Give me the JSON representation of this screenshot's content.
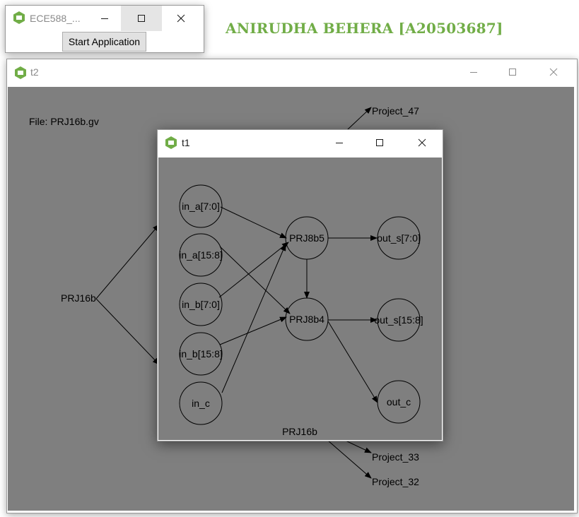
{
  "heading": "ANIRUDHA BEHERA [A20503687]",
  "colors": {
    "accent": "#71ad47",
    "canvas": "#7f7f7f",
    "titlebar": "#ffffff"
  },
  "main_window": {
    "title": "ECE588_...",
    "start_button": "Start Application",
    "icon": "app-icon"
  },
  "t2_window": {
    "title": "t2",
    "file_label": "File: PRJ16b.gv",
    "graph": {
      "nodes": [
        "PRJ16b",
        "Project_47",
        "Project_33",
        "Project_32"
      ]
    }
  },
  "t1_window": {
    "title": "t1",
    "caption": "PRJ16b",
    "graph": {
      "nodes": [
        "in_a[7:0]",
        "in_a[15:8]",
        "in_b[7:0]",
        "in_b[15:8]",
        "in_c",
        "PRJ8b5",
        "PRJ8b4",
        "out_s[7:0]",
        "out_s[15:8]",
        "out_c"
      ],
      "edges": [
        [
          "in_a[7:0]",
          "PRJ8b5"
        ],
        [
          "in_a[15:8]",
          "PRJ8b4"
        ],
        [
          "in_b[7:0]",
          "PRJ8b5"
        ],
        [
          "in_b[15:8]",
          "PRJ8b4"
        ],
        [
          "in_c",
          "PRJ8b5"
        ],
        [
          "PRJ8b5",
          "PRJ8b4"
        ],
        [
          "PRJ8b5",
          "out_s[7:0]"
        ],
        [
          "PRJ8b4",
          "out_s[15:8]"
        ],
        [
          "PRJ8b4",
          "out_c"
        ]
      ]
    }
  }
}
